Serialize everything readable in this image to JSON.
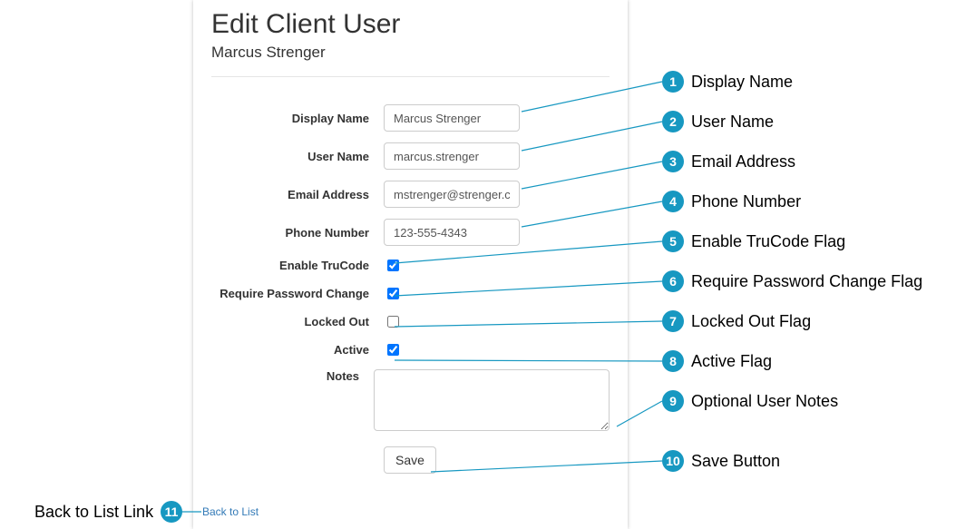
{
  "page": {
    "title": "Edit Client User",
    "subtitle": "Marcus Strenger"
  },
  "form": {
    "display_name": {
      "label": "Display Name",
      "value": "Marcus Strenger"
    },
    "user_name": {
      "label": "User Name",
      "value": "marcus.strenger"
    },
    "email": {
      "label": "Email Address",
      "value": "mstrenger@strenger.com"
    },
    "phone": {
      "label": "Phone Number",
      "value": "123-555-4343"
    },
    "enable_trucode": {
      "label": "Enable TruCode",
      "checked": true
    },
    "require_pw_change": {
      "label": "Require Password Change",
      "checked": true
    },
    "locked_out": {
      "label": "Locked Out",
      "checked": false
    },
    "active": {
      "label": "Active",
      "checked": true
    },
    "notes": {
      "label": "Notes",
      "value": ""
    },
    "save_label": "Save"
  },
  "links": {
    "back": "Back to List"
  },
  "annotations": [
    {
      "n": 1,
      "text": "Display Name"
    },
    {
      "n": 2,
      "text": "User Name"
    },
    {
      "n": 3,
      "text": "Email Address"
    },
    {
      "n": 4,
      "text": "Phone Number"
    },
    {
      "n": 5,
      "text": "Enable TruCode Flag"
    },
    {
      "n": 6,
      "text": "Require Password Change Flag"
    },
    {
      "n": 7,
      "text": "Locked Out Flag"
    },
    {
      "n": 8,
      "text": "Active Flag"
    },
    {
      "n": 9,
      "text": "Optional User Notes"
    },
    {
      "n": 10,
      "text": "Save Button"
    },
    {
      "n": 11,
      "text": "Back to List Link"
    }
  ],
  "colors": {
    "callout_blue": "#1798c1",
    "link_blue": "#337ab7"
  }
}
